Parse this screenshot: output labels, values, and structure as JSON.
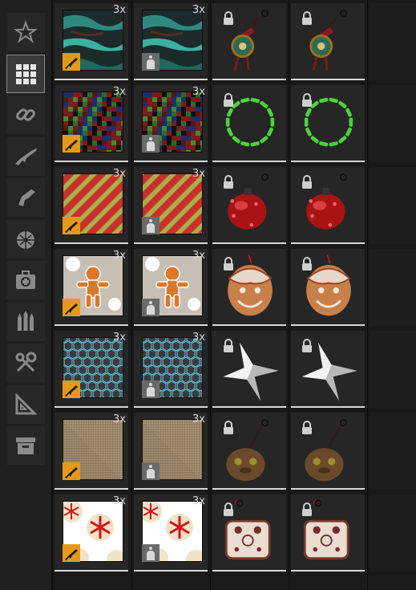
{
  "sidebar": {
    "items": [
      {
        "name": "favorites-icon"
      },
      {
        "name": "grid-icon",
        "active": true
      },
      {
        "name": "link-icon"
      },
      {
        "name": "rifle-icon"
      },
      {
        "name": "pistol-icon"
      },
      {
        "name": "grenade-icon"
      },
      {
        "name": "medkit-icon"
      },
      {
        "name": "ammo-icon"
      },
      {
        "name": "tools-icon"
      },
      {
        "name": "ruler-icon"
      },
      {
        "name": "archive-icon"
      }
    ]
  },
  "quantity_label": "3x",
  "rows": [
    {
      "pattern": "teal-camo",
      "charm": "dreamcatcher"
    },
    {
      "pattern": "pixel-camo",
      "charm": "green-ring"
    },
    {
      "pattern": "candy-stripe",
      "charm": "red-ornament"
    },
    {
      "pattern": "gingerbread",
      "charm": "gingerbread-face"
    },
    {
      "pattern": "hex-mesh",
      "charm": "silver-star"
    },
    {
      "pattern": "burlap",
      "charm": "cookie"
    },
    {
      "pattern": "snowflake-cookies",
      "charm": "cookie-square"
    }
  ],
  "colors": {
    "accent": "#e49a18",
    "panel": "#262626",
    "highlight": "#d9d9d9"
  }
}
